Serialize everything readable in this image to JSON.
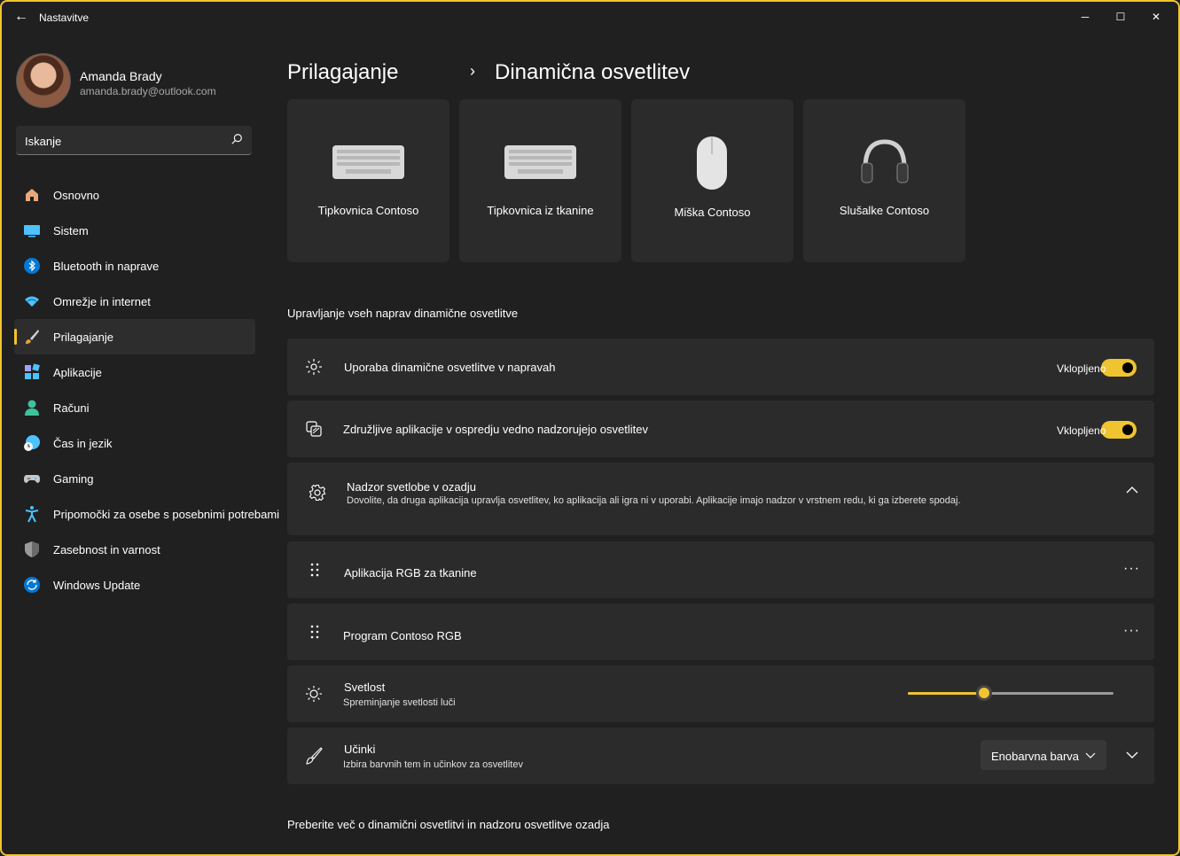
{
  "window": {
    "title": "Nastavitve",
    "back_glyph": "←",
    "minimize_glyph": "─",
    "maximize_glyph": "☐",
    "close_glyph": "✕",
    "accent": "#f0c430"
  },
  "user": {
    "name": "Amanda Brady",
    "email": "amanda.brady@outlook.com"
  },
  "search": {
    "placeholder": "Iskanje"
  },
  "nav": {
    "items": [
      {
        "label": "Osnovno",
        "icon": "home-icon"
      },
      {
        "label": "Sistem",
        "icon": "system-icon"
      },
      {
        "label": "Bluetooth in naprave",
        "icon": "bluetooth-icon"
      },
      {
        "label": "Omrežje in internet",
        "icon": "wifi-icon"
      },
      {
        "label": "Prilagajanje",
        "icon": "brush-icon",
        "active": true
      },
      {
        "label": "Aplikacije",
        "icon": "apps-icon"
      },
      {
        "label": "Računi",
        "icon": "account-icon"
      },
      {
        "label": "Čas in jezik",
        "icon": "clock-globe-icon"
      },
      {
        "label": "Gaming",
        "icon": "gamepad-icon"
      },
      {
        "label": "Pripomočki za osebe s posebnimi potrebami",
        "icon": "accessibility-icon"
      },
      {
        "label": "Zasebnost in varnost",
        "icon": "shield-icon"
      },
      {
        "label": "Windows Update",
        "icon": "update-icon"
      }
    ]
  },
  "breadcrumb": {
    "parent": "Prilagajanje",
    "separator": "›",
    "current": "Dinamična osvetlitev"
  },
  "devices": [
    {
      "label": "Tipkovnica Contoso",
      "icon": "keyboard-icon"
    },
    {
      "label": "Tipkovnica iz tkanine",
      "icon": "keyboard-icon"
    },
    {
      "label": "Miška Contoso",
      "icon": "mouse-icon"
    },
    {
      "label": "Slušalke Contoso",
      "icon": "headphones-icon"
    }
  ],
  "section": {
    "title": "Upravljanje vseh naprav dinamične osvetlitve"
  },
  "settings": {
    "use_dynamic": {
      "title": "Uporaba dinamične osvetlitve v napravah",
      "state": "Vklopljeno",
      "on": true
    },
    "foreground": {
      "title": "Združljive aplikacije v ospredju vedno nadzorujejo osvetlitev",
      "state": "Vklopljeno",
      "on": true
    },
    "background": {
      "title": "Nadzor svetlobe v ozadju",
      "subtitle": "Dovolite, da druga aplikacija upravlja osvetlitev, ko aplikacija ali igra ni v uporabi. Aplikacije imajo nadzor v vrstnem redu, ki ga izberete spodaj."
    },
    "apps": [
      {
        "title": "Aplikacija RGB za tkanine",
        "more": "···"
      },
      {
        "title": "Program Contoso RGB",
        "more": "···"
      }
    ],
    "brightness": {
      "title": "Svetlost",
      "subtitle": "Spreminjanje svetlosti luči",
      "value": 0.37
    },
    "effects": {
      "title": "Učinki",
      "subtitle": "Izbira barvnih tem in učinkov za osvetlitev",
      "selected": "Enobarvna barva"
    }
  },
  "footer": {
    "link": "Preberite več o dinamični osvetlitvi in nadzoru osvetlitve ozadja"
  }
}
